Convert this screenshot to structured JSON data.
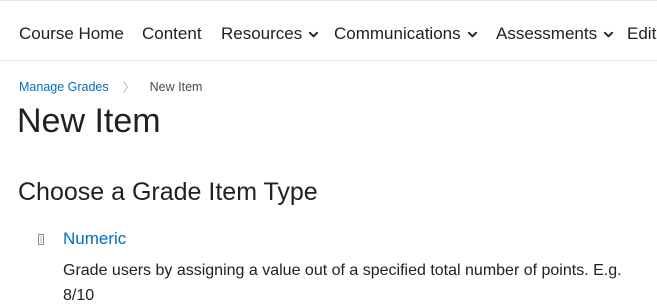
{
  "nav": {
    "items": [
      {
        "label": "Course Home",
        "dropdown": false
      },
      {
        "label": "Content",
        "dropdown": false
      },
      {
        "label": "Resources",
        "dropdown": true
      },
      {
        "label": "Communications",
        "dropdown": true
      },
      {
        "label": "Assessments",
        "dropdown": true
      },
      {
        "label": "Edit",
        "dropdown": false
      }
    ]
  },
  "breadcrumb": {
    "parent": "Manage Grades",
    "current": "New Item"
  },
  "page": {
    "title": "New Item",
    "section_title": "Choose a Grade Item Type"
  },
  "option": {
    "label": "Numeric",
    "icon": "numeric-type-icon",
    "description": "Grade users by assigning a value out of a specified total number of points. E.g. 8/10"
  },
  "colors": {
    "link": "#006fbf",
    "text": "#202122",
    "muted": "#494c4e"
  }
}
